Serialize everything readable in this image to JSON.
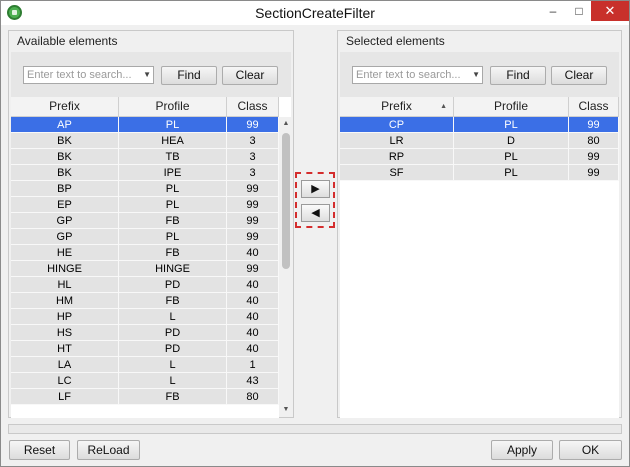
{
  "window": {
    "title": "SectionCreateFilter",
    "minimize": "–",
    "maximize": "□",
    "close": "✕"
  },
  "available": {
    "title": "Available elements",
    "search_placeholder": "Enter text to search...",
    "find_label": "Find",
    "clear_label": "Clear",
    "columns": [
      "Prefix",
      "Profile",
      "Class"
    ],
    "rows": [
      [
        "AP",
        "PL",
        "99"
      ],
      [
        "BK",
        "HEA",
        "3"
      ],
      [
        "BK",
        "TB",
        "3"
      ],
      [
        "BK",
        "IPE",
        "3"
      ],
      [
        "BP",
        "PL",
        "99"
      ],
      [
        "EP",
        "PL",
        "99"
      ],
      [
        "GP",
        "FB",
        "99"
      ],
      [
        "GP",
        "PL",
        "99"
      ],
      [
        "HE",
        "FB",
        "40"
      ],
      [
        "HINGE",
        "HINGE",
        "99"
      ],
      [
        "HL",
        "PD",
        "40"
      ],
      [
        "HM",
        "FB",
        "40"
      ],
      [
        "HP",
        "L",
        "40"
      ],
      [
        "HS",
        "PD",
        "40"
      ],
      [
        "HT",
        "PD",
        "40"
      ],
      [
        "LA",
        "L",
        "1"
      ],
      [
        "LC",
        "L",
        "43"
      ],
      [
        "LF",
        "FB",
        "80"
      ]
    ],
    "selected_row": 0
  },
  "selected": {
    "title": "Selected elements",
    "search_placeholder": "Enter text to search...",
    "find_label": "Find",
    "clear_label": "Clear",
    "columns": [
      "Prefix",
      "Profile",
      "Class"
    ],
    "sorted_column": "Prefix",
    "rows": [
      [
        "CP",
        "PL",
        "99"
      ],
      [
        "LR",
        "D",
        "80"
      ],
      [
        "RP",
        "PL",
        "99"
      ],
      [
        "SF",
        "PL",
        "99"
      ]
    ],
    "selected_row": 0
  },
  "transfer": {
    "add_label": "▶",
    "remove_label": "◀"
  },
  "footer": {
    "reset_label": "Reset",
    "reload_label": "ReLoad",
    "apply_label": "Apply",
    "ok_label": "OK"
  },
  "colors": {
    "selection": "#3b6fe6",
    "row_bg": "#e3e3e3",
    "highlight_box": "#d42d2d",
    "close_button": "#c8302b"
  },
  "icons": {
    "app": "app-gear-icon",
    "dropdown": "chevron-down-icon"
  }
}
